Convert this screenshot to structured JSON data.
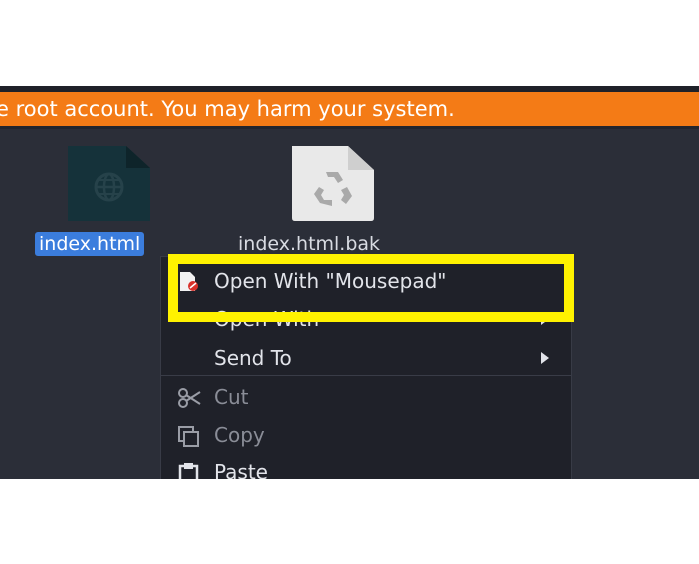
{
  "warning": {
    "text": "e root account. You may harm your system.",
    "color": "#f47b16"
  },
  "files": [
    {
      "name": "index.html",
      "icon": "web-file-icon",
      "selected": true
    },
    {
      "name": "index.html.bak",
      "icon": "backup-file-icon",
      "selected": false
    }
  ],
  "context_menu": {
    "items": [
      {
        "label": "Open With \"Mousepad\"",
        "icon": "mousepad-icon",
        "submenu": false,
        "enabled": true
      },
      {
        "label": "Open With",
        "icon": "",
        "submenu": true,
        "enabled": true
      },
      {
        "label": "Send To",
        "icon": "",
        "submenu": true,
        "enabled": true
      },
      {
        "label": "Cut",
        "icon": "scissors-icon",
        "submenu": false,
        "enabled": false
      },
      {
        "label": "Copy",
        "icon": "copy-icon",
        "submenu": false,
        "enabled": false
      },
      {
        "label": "Paste",
        "icon": "clipboard-icon",
        "submenu": false,
        "enabled": true
      }
    ]
  },
  "annotation": {
    "highlight_color": "#fff200"
  }
}
